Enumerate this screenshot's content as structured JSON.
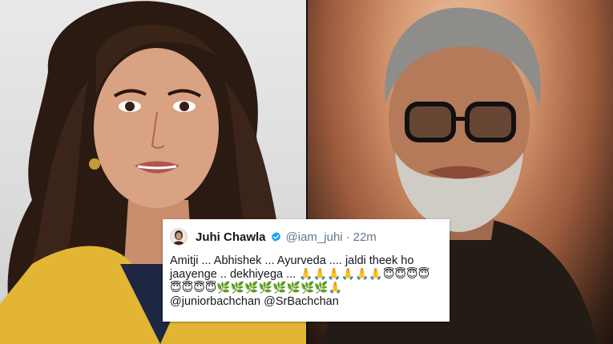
{
  "tweet": {
    "display_name": "Juhi Chawla",
    "handle": "@iam_juhi",
    "separator": "·",
    "time": "22m",
    "line1": "Amitji ... Abhishek ... Ayurveda .... jaldi theek ho",
    "line2_text": "jaayenge .. dekhiyega ... ",
    "line2_emojis": "🙏🙏🙏🙏🙏🙏😇😇😇😇",
    "line3_emojis": "😇😇😇😇🌿🌿🌿🌿🌿🌿🌿🌿🙏",
    "mentions": "@juniorbachchan @SrBachchan"
  },
  "colors": {
    "verified": "#1da1f2",
    "text": "#14171a",
    "secondary": "#657786"
  },
  "icons": {
    "verified": "verified-badge-icon",
    "avatar": "profile-avatar"
  }
}
